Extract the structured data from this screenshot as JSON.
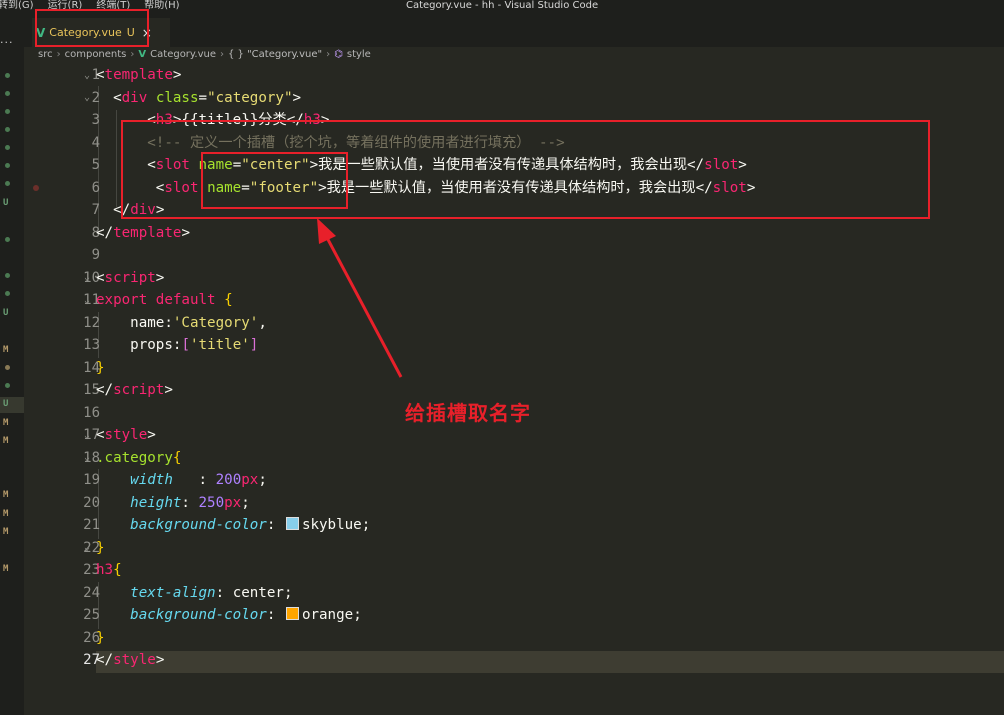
{
  "titlebar": {
    "menu": [
      "转到(G)",
      "运行(R)",
      "终端(T)",
      "帮助(H)"
    ],
    "window_title": "Category.vue - hh - Visual Studio Code"
  },
  "tab": {
    "filename": "Category.vue",
    "badge": "U",
    "close": "×",
    "icon": "vue-icon"
  },
  "breadcrumb": {
    "items": [
      "src",
      "components",
      "Category.vue",
      "{ } \"Category.vue\"",
      "style"
    ]
  },
  "editor": {
    "line_numbers": [
      "1",
      "2",
      "3",
      "4",
      "5",
      "6",
      "7",
      "8",
      "9",
      "10",
      "11",
      "12",
      "13",
      "14",
      "15",
      "16",
      "17",
      "18",
      "19",
      "20",
      "21",
      "22",
      "23",
      "24",
      "25",
      "26",
      "27"
    ],
    "active_line": "27",
    "lines": {
      "l1_open": "<",
      "l1_tag": "template",
      "l1_close": ">",
      "l2_indent": "  ",
      "l2_open": "<",
      "l2_tag": "div",
      "l2_sp": " ",
      "l2_attr": "class",
      "l2_eq": "=",
      "l2_val": "\"category\"",
      "l2_close": ">",
      "l3_indent": "      ",
      "l3_open": "<",
      "l3_tag": "h3",
      "l3_gt": ">",
      "l3_text": "{{title}}分类",
      "l3_end_open": "</",
      "l3_end_tag": "h3",
      "l3_end_close": ">",
      "l4_indent": "      ",
      "l4_comment": "<!-- 定义一个插槽（挖个坑，等着组件的使用者进行填充） -->",
      "l5_indent": "      ",
      "l5_open": "<",
      "l5_tag": "slot",
      "l5_sp": " ",
      "l5_attr": "name",
      "l5_eq": "=",
      "l5_val": "\"center\"",
      "l5_gt": ">",
      "l5_text": "我是一些默认值，当使用者没有传递具体结构时，我会出现",
      "l5_end_open": "</",
      "l5_end_tag": "slot",
      "l5_end_close": ">",
      "l6_indent": "       ",
      "l6_open": "<",
      "l6_tag": "slot",
      "l6_sp": " ",
      "l6_attr": "name",
      "l6_eq": "=",
      "l6_val": "\"footer\"",
      "l6_gt": ">",
      "l6_text": "我是一些默认值，当使用者没有传递具体结构时，我会出现",
      "l6_end_open": "</",
      "l6_end_tag": "slot",
      "l6_end_close": ">",
      "l7_indent": "  ",
      "l7_open": "</",
      "l7_tag": "div",
      "l7_close": ">",
      "l8_open": "</",
      "l8_tag": "template",
      "l8_close": ">",
      "l10_open": "<",
      "l10_tag": "script",
      "l10_close": ">",
      "l11_kw": "export",
      "l11_sp": " ",
      "l11_kw2": "default",
      "l11_sp2": " ",
      "l11_brace": "{",
      "l12_indent": "    ",
      "l12_key": "name",
      "l12_colon": ":",
      "l12_val": "'Category'",
      "l12_comma": ",",
      "l13_indent": "    ",
      "l13_key": "props",
      "l13_colon": ":",
      "l13_ob": "[",
      "l13_val": "'title'",
      "l13_cb": "]",
      "l14_brace": "}",
      "l15_open": "</",
      "l15_tag": "script",
      "l15_close": ">",
      "l17_open": "<",
      "l17_tag": "style",
      "l17_close": ">",
      "l18_sel": ".category",
      "l18_brace": "{",
      "l19_indent": "    ",
      "l19_prop": "width",
      "l19_sp": "   ",
      "l19_colon": ": ",
      "l19_num": "200",
      "l19_unit": "px",
      "l19_semi": ";",
      "l20_indent": "    ",
      "l20_prop": "height",
      "l20_colon": ": ",
      "l20_num": "250",
      "l20_unit": "px",
      "l20_semi": ";",
      "l21_indent": "    ",
      "l21_prop": "background-color",
      "l21_colon": ": ",
      "l21_val": "skyblue",
      "l21_semi": ";",
      "l22_brace": "}",
      "l23_sel": "h3",
      "l23_brace": "{",
      "l24_indent": "    ",
      "l24_prop": "text-align",
      "l24_colon": ": ",
      "l24_val": "center",
      "l24_semi": ";",
      "l25_indent": "    ",
      "l25_prop": "background-color",
      "l25_colon": ": ",
      "l25_val": "orange",
      "l25_semi": ";",
      "l26_brace": "}",
      "l27_open": "</",
      "l27_tag": "style",
      "l27_close": ">"
    }
  },
  "annotation": {
    "label": "给插槽取名字",
    "color": "#e8202a"
  },
  "colors": {
    "skyblue": "#87ceeb",
    "orange": "#ffa500",
    "accent_red": "#e8202a"
  },
  "git_marks": {
    "u": "U",
    "m": "M"
  }
}
